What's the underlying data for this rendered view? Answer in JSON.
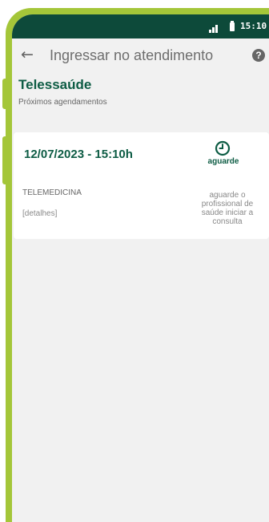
{
  "status_bar": {
    "time": "15:10",
    "signal_icon": "signal-icon",
    "battery_icon": "battery-icon"
  },
  "app_bar": {
    "back_icon": "arrow-left-icon",
    "title": "Ingressar no atendimento",
    "help_icon": "help-icon",
    "help_glyph": "?"
  },
  "section": {
    "title": "Telessaúde",
    "subtitle": "Próximos agendamentos"
  },
  "appointments": [
    {
      "date": "12/07/2023 - 15:10h",
      "type": "TELEMEDICINA",
      "details_link": "[detalhes]",
      "status_icon": "clock-icon",
      "status": "aguarde",
      "message": "aguarde o profissional de saúde iniciar a consulta"
    }
  ],
  "colors": {
    "accent_green": "#a4c639",
    "dark_green": "#0d4a3a",
    "text_green": "#0d5c44"
  }
}
